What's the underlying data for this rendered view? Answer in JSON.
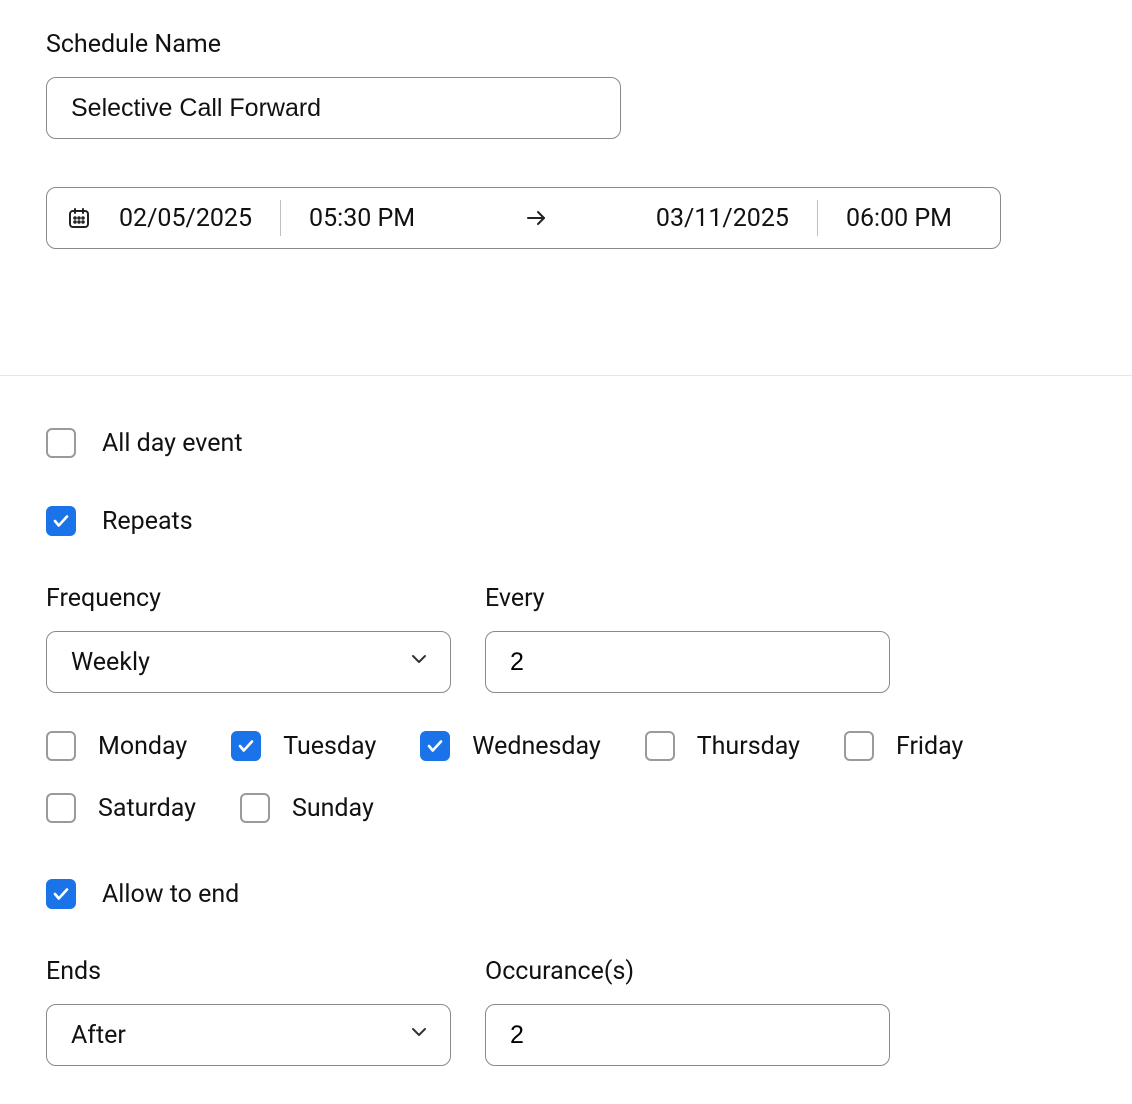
{
  "schedule": {
    "name_label": "Schedule Name",
    "name_value": "Selective Call Forward"
  },
  "dateRange": {
    "start_date": "02/05/2025",
    "start_time": "05:30 PM",
    "end_date": "03/11/2025",
    "end_time": "06:00 PM"
  },
  "options": {
    "all_day_label": "All day event",
    "all_day_checked": false,
    "repeats_label": "Repeats",
    "repeats_checked": true,
    "frequency_label": "Frequency",
    "frequency_value": "Weekly",
    "every_label": "Every",
    "every_value": "2",
    "days": [
      {
        "label": "Monday",
        "checked": false
      },
      {
        "label": "Tuesday",
        "checked": true
      },
      {
        "label": "Wednesday",
        "checked": true
      },
      {
        "label": "Thursday",
        "checked": false
      },
      {
        "label": "Friday",
        "checked": false
      },
      {
        "label": "Saturday",
        "checked": false
      },
      {
        "label": "Sunday",
        "checked": false
      }
    ],
    "allow_end_label": "Allow to end",
    "allow_end_checked": true,
    "ends_label": "Ends",
    "ends_value": "After",
    "occurrences_label": "Occurance(s)",
    "occurrences_value": "2"
  }
}
